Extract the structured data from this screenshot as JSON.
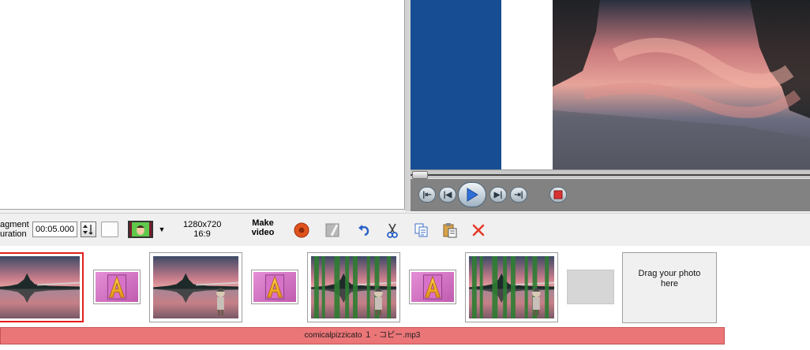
{
  "toolbar": {
    "fragment_label_1": "agment",
    "fragment_label_2": "uration",
    "duration_value": "00:05.000",
    "resolution": "1280x720",
    "aspect": "16:9",
    "make_video_1": "Make",
    "make_video_2": "video"
  },
  "timeline": {
    "drop_zone_text": "Drag your photo here",
    "audio_track_name": "comicalpizzicato １ - コピー.mp3"
  },
  "icons": {
    "record": "record-icon",
    "save": "save-icon",
    "undo": "undo-icon",
    "cut": "scissors-icon",
    "copy": "copy-icon",
    "paste": "paste-icon",
    "delete": "delete-x-icon"
  },
  "colors": {
    "preview_blue": "#174e93",
    "audio_track": "#eb7678",
    "selection": "#e21e1e",
    "delete": "#e53b2a",
    "record": "#e0531c"
  }
}
